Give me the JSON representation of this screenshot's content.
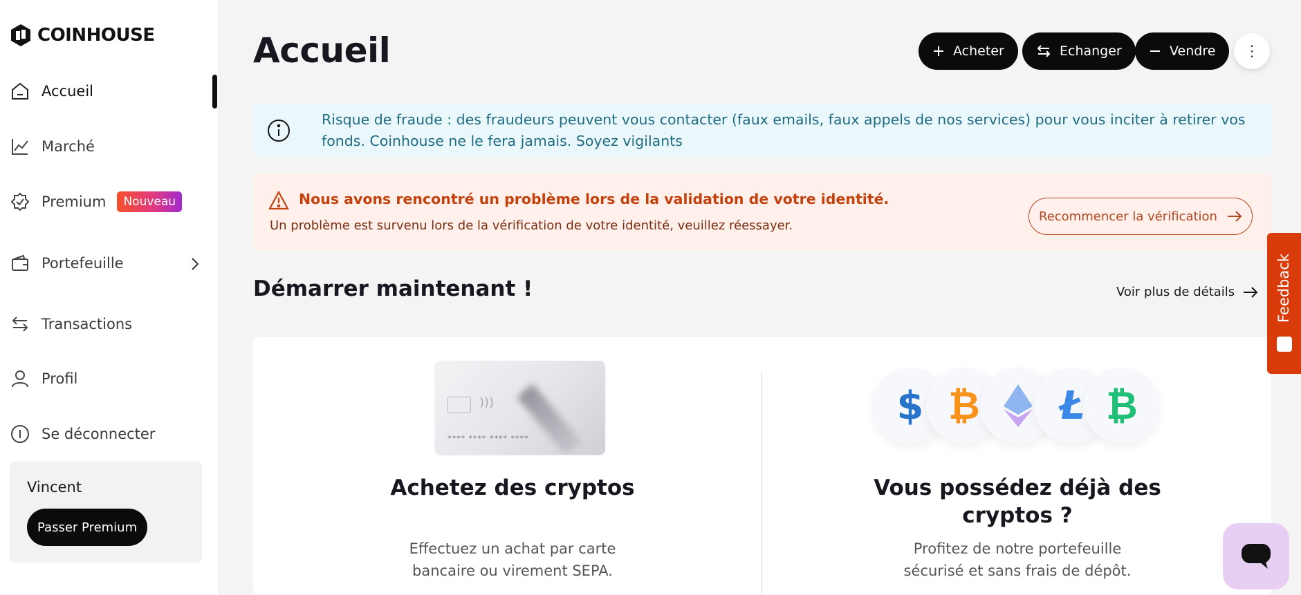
{
  "brand": {
    "name": "COINHOUSE"
  },
  "sidebar": {
    "items": [
      {
        "label": "Accueil",
        "icon": "home-icon",
        "active": true
      },
      {
        "label": "Marché",
        "icon": "chart-line-icon"
      },
      {
        "label": "Premium",
        "icon": "badge-check-icon",
        "badge": "Nouveau"
      },
      {
        "label": "Portefeuille",
        "icon": "wallet-icon",
        "has_chevron": true
      },
      {
        "label": "Transactions",
        "icon": "arrows-swap-icon"
      },
      {
        "label": "Profil",
        "icon": "user-icon"
      },
      {
        "label": "Se déconnecter",
        "icon": "power-icon"
      }
    ],
    "user": {
      "name": "Vincent",
      "cta": "Passer Premium"
    }
  },
  "header": {
    "title": "Accueil",
    "buttons": {
      "buy": "Acheter",
      "exchange": "Echanger",
      "sell": "Vendre"
    }
  },
  "alerts": {
    "fraud": "Risque de fraude : des fraudeurs peuvent vous contacter (faux emails, faux appels de nos services) pour vous inciter à retirer vos fonds. Coinhouse ne le fera jamais. Soyez vigilants",
    "identity": {
      "title": "Nous avons rencontré un problème lors de la validation de votre identité.",
      "message": "Un problème est survenu lors de la vérification de votre identité, veuillez réessayer.",
      "action": "Recommencer la vérification"
    }
  },
  "start": {
    "title": "Démarrer maintenant !",
    "details_link": "Voir plus de détails",
    "cards": [
      {
        "title": "Achetez des cryptos",
        "description": "Effectuez un achat par carte bancaire ou virement SEPA.",
        "card_number": "**** **** **** ****"
      },
      {
        "title": "Vous possédez déjà des cryptos ?",
        "description": "Profitez de notre portefeuille sécurisé et sans frais de dépôt."
      }
    ]
  },
  "feedback": {
    "label": "Feedback"
  },
  "colors": {
    "accent": "#0b0b0b",
    "warning": "#c2410c",
    "info": "#1e6b82",
    "feedback": "#d93b0a"
  }
}
